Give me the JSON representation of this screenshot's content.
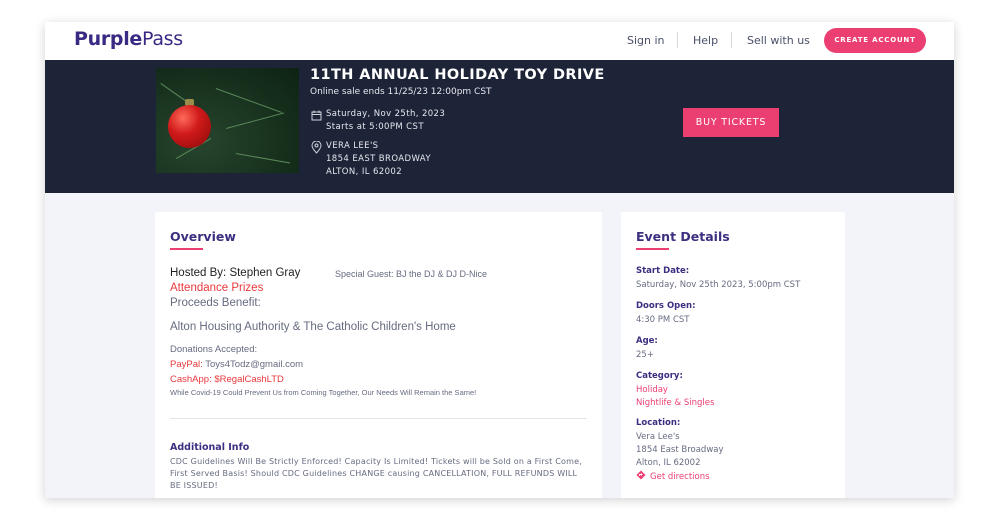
{
  "header": {
    "logo_bold": "Purple",
    "logo_light": "Pass",
    "nav": {
      "signin": "Sign in",
      "help": "Help",
      "sell": "Sell with us"
    },
    "create_account": "CREATE ACCOUNT"
  },
  "hero": {
    "title": "11TH ANNUAL HOLIDAY TOY DRIVE",
    "sale_ends": "Online sale ends 11/25/23 12:00pm CST",
    "date": "Saturday, Nov 25th, 2023",
    "start_time": "Starts at 5:00PM CST",
    "venue_name": "VERA LEE'S",
    "venue_street": "1854 EAST BROADWAY",
    "venue_city": "ALTON, IL 62002",
    "buy_tickets": "BUY TICKETS",
    "image_icon": "christmas-ornament-image"
  },
  "overview": {
    "heading": "Overview",
    "hosted_by": "Hosted By: Stephen Gray",
    "special_guest": "Special Guest: BJ the DJ  & DJ D-Nice",
    "attendance_prizes": "Attendance Prizes",
    "proceeds_benefit": "Proceeds Benefit:",
    "beneficiaries": "Alton Housing Authority & The Catholic Children's Home",
    "donations_accepted": "Donations Accepted:",
    "paypal_label": "PayPal:",
    "paypal_value": " Toys4Todz@gmail.com",
    "cashapp": "CashApp: $RegalCashLTD",
    "covid_note": "While Covid-19 Could Prevent Us from Coming Together, Our Needs Will Remain the Same!",
    "additional_heading": "Additional Info",
    "additional_text": "CDC Guidelines Will Be Strictly Enforced! Capacity Is Limited! Tickets will be Sold on a First Come, First Served Basis! Should CDC Guidelines CHANGE causing CANCELLATION, FULL REFUNDS WILL BE ISSUED!"
  },
  "details": {
    "heading": "Event Details",
    "start_date_label": "Start Date:",
    "start_date_value": "Saturday, Nov 25th 2023, 5:00pm CST",
    "doors_label": "Doors Open:",
    "doors_value": "4:30 PM CST",
    "age_label": "Age:",
    "age_value": "25+",
    "category_label": "Category:",
    "category_1": "Holiday",
    "category_2": "Nightlife & Singles",
    "location_label": "Location:",
    "location_1": "Vera Lee's",
    "location_2": "1854 East Broadway",
    "location_3": "Alton, IL 62002",
    "directions": "Get directions"
  },
  "colors": {
    "brand_purple": "#3b2a84",
    "accent_pink": "#ec3f71",
    "hero_bg": "#1e2438",
    "alert_red": "#e9383c"
  }
}
